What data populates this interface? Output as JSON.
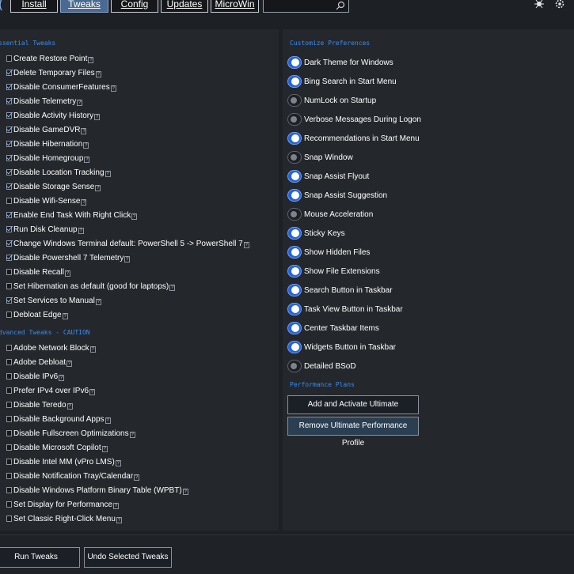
{
  "tabs": [
    {
      "label": "Install",
      "active": false
    },
    {
      "label": "Tweaks",
      "active": true
    },
    {
      "label": "Config",
      "active": false
    },
    {
      "label": "Updates",
      "active": false
    },
    {
      "label": "MicroWin",
      "active": false
    }
  ],
  "search": {
    "value": "",
    "placeholder": ""
  },
  "essential": {
    "title": "ssential Tweaks",
    "items": [
      {
        "label": "Create Restore Point",
        "checked": false
      },
      {
        "label": "Delete Temporary Files",
        "checked": true
      },
      {
        "label": "Disable ConsumerFeatures",
        "checked": true
      },
      {
        "label": "Disable Telemetry",
        "checked": true
      },
      {
        "label": "Disable Activity History",
        "checked": true
      },
      {
        "label": "Disable GameDVR",
        "checked": true
      },
      {
        "label": "Disable Hibernation",
        "checked": true
      },
      {
        "label": "Disable Homegroup",
        "checked": true
      },
      {
        "label": "Disable Location Tracking",
        "checked": true
      },
      {
        "label": "Disable Storage Sense",
        "checked": true
      },
      {
        "label": "Disable Wifi-Sense",
        "checked": false
      },
      {
        "label": "Enable End Task With Right Click",
        "checked": true
      },
      {
        "label": "Run Disk Cleanup",
        "checked": true
      },
      {
        "label": "Change Windows Terminal default: PowerShell 5 -> PowerShell 7",
        "checked": true
      },
      {
        "label": "Disable Powershell 7 Telemetry",
        "checked": true
      },
      {
        "label": "Disable Recall",
        "checked": false
      },
      {
        "label": "Set Hibernation as default (good for laptops)",
        "checked": false
      },
      {
        "label": "Set Services to Manual",
        "checked": true
      },
      {
        "label": "Debloat Edge",
        "checked": false
      }
    ]
  },
  "advanced": {
    "title": "dvanced Tweaks - CAUTION",
    "items": [
      {
        "label": "Adobe Network Block",
        "checked": false
      },
      {
        "label": "Adobe Debloat",
        "checked": false
      },
      {
        "label": "Disable IPv6",
        "checked": false
      },
      {
        "label": "Prefer IPv4 over IPv6",
        "checked": false
      },
      {
        "label": "Disable Teredo",
        "checked": false
      },
      {
        "label": "Disable Background Apps",
        "checked": false
      },
      {
        "label": "Disable Fullscreen Optimizations",
        "checked": false
      },
      {
        "label": "Disable Microsoft Copilot",
        "checked": false
      },
      {
        "label": "Disable Intel MM (vPro LMS)",
        "checked": false
      },
      {
        "label": "Disable Notification Tray/Calendar",
        "checked": false
      },
      {
        "label": "Disable Windows Platform Binary Table (WPBT)",
        "checked": false
      },
      {
        "label": "Set Display for Performance",
        "checked": false
      },
      {
        "label": "Set Classic Right-Click Menu",
        "checked": false
      }
    ]
  },
  "preferences": {
    "title": "Customize Preferences",
    "items": [
      {
        "label": "Dark Theme for Windows",
        "on": true
      },
      {
        "label": "Bing Search in Start Menu",
        "on": true
      },
      {
        "label": "NumLock on Startup",
        "on": false
      },
      {
        "label": "Verbose Messages During Logon",
        "on": false
      },
      {
        "label": "Recommendations in Start Menu",
        "on": true
      },
      {
        "label": "Snap Window",
        "on": false
      },
      {
        "label": "Snap Assist Flyout",
        "on": true
      },
      {
        "label": "Snap Assist Suggestion",
        "on": true
      },
      {
        "label": "Mouse Acceleration",
        "on": false
      },
      {
        "label": "Sticky Keys",
        "on": true
      },
      {
        "label": "Show Hidden Files",
        "on": true
      },
      {
        "label": "Show File Extensions",
        "on": true
      },
      {
        "label": "Search Button in Taskbar",
        "on": true
      },
      {
        "label": "Task View Button in Taskbar",
        "on": true
      },
      {
        "label": "Center Taskbar Items",
        "on": true
      },
      {
        "label": "Widgets Button in Taskbar",
        "on": true
      },
      {
        "label": "Detailed BSoD",
        "on": false
      }
    ]
  },
  "performance": {
    "title": "Performance Plans",
    "add_label": "Add and Activate Ultimate Performance Profile",
    "remove_label": "Remove Ultimate Performance Profile"
  },
  "bottom": {
    "run_label": "Run Tweaks",
    "undo_label": "Undo Selected Tweaks"
  },
  "help_glyph": "?",
  "icons": [
    "search-icon",
    "bug-icon",
    "settings-icon"
  ],
  "colors": {
    "accent": "#3a8cf0",
    "toggle_on": "#2563d8",
    "background": "#1d2025",
    "active_tab": "#4a6a91"
  }
}
